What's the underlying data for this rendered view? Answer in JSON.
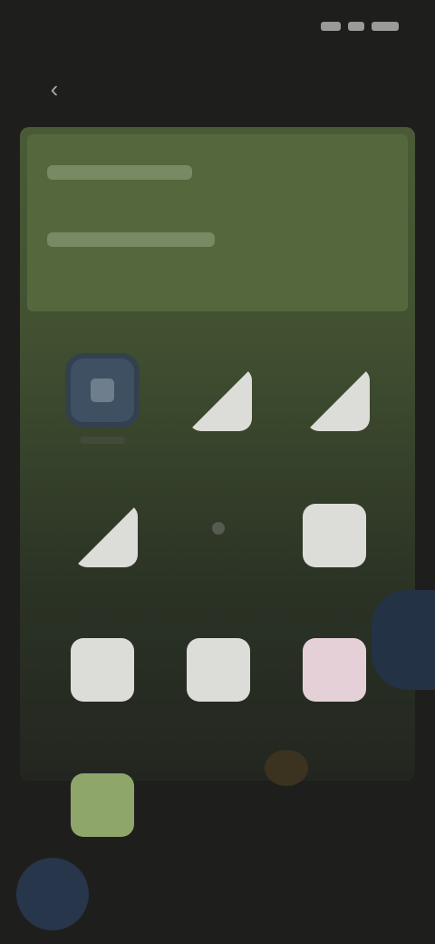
{
  "status_bar": {
    "time": "",
    "icons": [
      "signal-icon",
      "wifi-icon",
      "battery-icon"
    ]
  },
  "top_bar": {
    "back_icon": "back-arrow-icon",
    "title": "",
    "action_label": ""
  },
  "header_card": {
    "title": "",
    "subtitle": ""
  },
  "grid": {
    "items": [
      {
        "icon": "active-tile-icon",
        "label": ""
      },
      {
        "icon": "signal-tile-icon",
        "label": ""
      },
      {
        "icon": "signal-tile-icon",
        "label": ""
      },
      {
        "icon": "signal-tile-icon",
        "label": ""
      },
      {
        "icon": "dot-tile-icon",
        "label": ""
      },
      {
        "icon": "tile-icon",
        "label": ""
      },
      {
        "icon": "tile-icon",
        "label": ""
      },
      {
        "icon": "tile-icon",
        "label": ""
      },
      {
        "icon": "tile-icon",
        "label": ""
      },
      {
        "icon": "tile-icon",
        "label": ""
      }
    ]
  },
  "colors": {
    "background": "#1e1f1d",
    "panel_green": "#55683d",
    "accent_blue": "#3e5062",
    "tile_light": "#dcdcd8",
    "tile_pink": "#e6d0d8",
    "tile_green": "#8fa66a"
  }
}
